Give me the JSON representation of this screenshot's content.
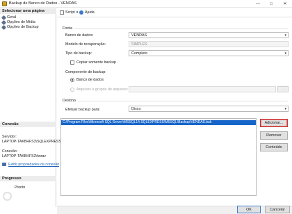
{
  "window": {
    "title": "Backup de Banco de Dados - VENDAS"
  },
  "sidebar": {
    "header": "Selecionar uma página",
    "items": [
      {
        "label": "Geral"
      },
      {
        "label": "Opções de Mídia"
      },
      {
        "label": "Opções de Backup"
      }
    ]
  },
  "connection": {
    "header": "Conexão",
    "server_label": "Servidor:",
    "server_value": "LAPTOP-TAKBHFS3\\SQLEXPRESS",
    "conn_label": "Conexão:",
    "conn_value": "LAPTOP-TAKBHFS3\\hnrav",
    "link": "Exibir propriedades da conexão"
  },
  "progress": {
    "header": "Progresso",
    "status": "Pronto"
  },
  "toolbar": {
    "script": "Script",
    "help": "Ajuda"
  },
  "source": {
    "group": "Fonte",
    "db_label": "Banco de dados:",
    "db_value": "VENDAS",
    "recovery_label": "Modelo de recuperação:",
    "recovery_value": "SIMPLES",
    "type_label": "Tipo de backup:",
    "type_value": "Completo",
    "copy_only": "Copiar somente backup",
    "component_label": "Componente de backup:",
    "opt_db": "Banco de dados",
    "opt_files": "Arquivos e grupos de arquivos:"
  },
  "destination": {
    "group": "Destino",
    "to_label": "Efetuar backup para:",
    "to_value": "Disco",
    "path": "C:\\Program Files\\Microsoft SQL Server\\MSSQL14.SQLEXPRESS\\MSSQL\\Backup\\VENDAS.bak",
    "add": "Adicionar...",
    "remove": "Remover",
    "contents": "Conteúdo"
  },
  "footer": {
    "ok": "OK",
    "cancel": "Cancelar"
  }
}
